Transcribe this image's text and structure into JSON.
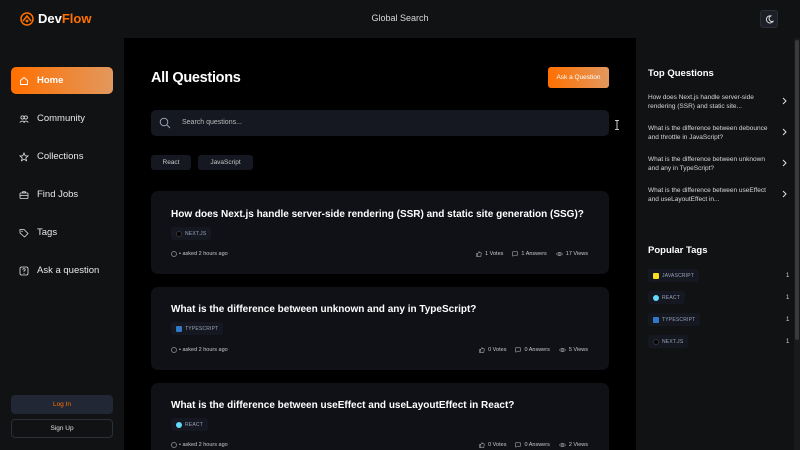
{
  "header": {
    "logo_prefix": "Dev",
    "logo_suffix": "Flow",
    "global_search": "Global Search"
  },
  "sidebar": {
    "items": [
      {
        "label": "Home",
        "icon": "home-icon",
        "active": true
      },
      {
        "label": "Community",
        "icon": "users-icon",
        "active": false
      },
      {
        "label": "Collections",
        "icon": "star-icon",
        "active": false
      },
      {
        "label": "Find Jobs",
        "icon": "briefcase-icon",
        "active": false
      },
      {
        "label": "Tags",
        "icon": "tag-icon",
        "active": false
      },
      {
        "label": "Ask a question",
        "icon": "question-icon",
        "active": false
      }
    ],
    "login": "Log In",
    "signup": "Sign Up"
  },
  "main": {
    "title": "All Questions",
    "ask_button": "Ask a Question",
    "search_placeholder": "Search questions...",
    "filters": [
      "React",
      "JavaScript"
    ],
    "questions": [
      {
        "title": "How does Next.js handle server-side rendering (SSR) and static site generation (SSG)?",
        "tag": "NEXT.JS",
        "asked": "• asked 2 hours ago",
        "votes": "1 Votes",
        "answers": "1 Answers",
        "views": "17 Views"
      },
      {
        "title": "What is the difference between unknown and any in TypeScript?",
        "tag": "TYPESCRIPT",
        "asked": "• asked 2 hours ago",
        "votes": "0 Votes",
        "answers": "0 Answers",
        "views": "5 Views"
      },
      {
        "title": "What is the difference between useEffect and useLayoutEffect in React?",
        "tag": "REACT",
        "asked": "• asked 2 hours ago",
        "votes": "0 Votes",
        "answers": "0 Answers",
        "views": "2 Views"
      }
    ]
  },
  "right_sidebar": {
    "top_questions_title": "Top Questions",
    "top_questions": [
      "How does Next.js handle server-side rendering (SSR) and static site...",
      "What is the difference between debounce and throttle in JavaScript?",
      "What is the difference between unknown and any in TypeScript?",
      "What is the difference between useEffect and useLayoutEffect in..."
    ],
    "popular_tags_title": "Popular Tags",
    "popular_tags": [
      {
        "name": "JAVASCRIPT",
        "count": "1",
        "color": "#f7df1e"
      },
      {
        "name": "REACT",
        "count": "1",
        "color": "#61dafb"
      },
      {
        "name": "TYPESCRIPT",
        "count": "1",
        "color": "#3178c6"
      },
      {
        "name": "NEXT.JS",
        "count": "1",
        "color": "#000000"
      }
    ]
  },
  "colors": {
    "accent": "#ff7000",
    "accent_light": "#e2985e",
    "background": "#000000",
    "panel": "#111213",
    "card": "#0f1117"
  }
}
